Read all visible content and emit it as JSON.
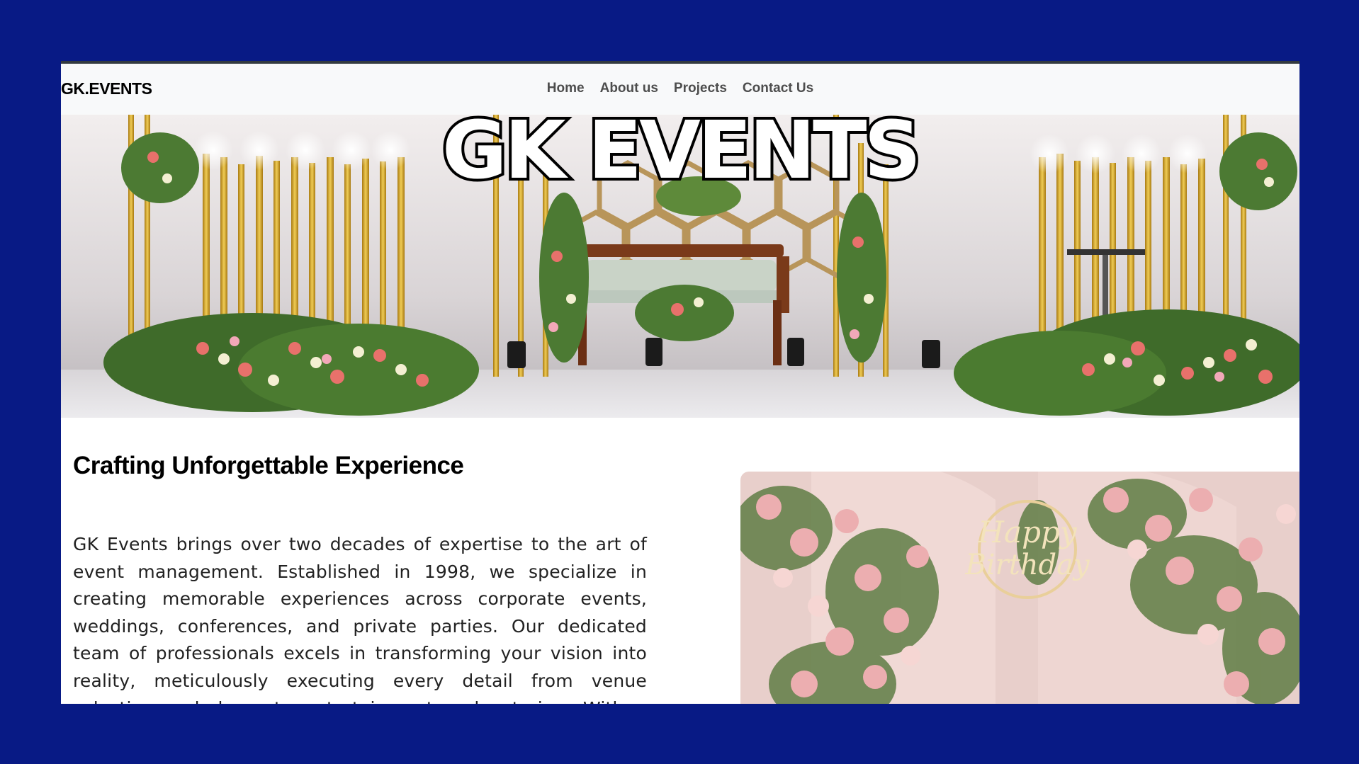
{
  "navbar": {
    "brand": "GK.EVENTS",
    "links": [
      "Home",
      "About us",
      "Projects",
      "Contact Us"
    ]
  },
  "hero": {
    "title": "GK EVENTS"
  },
  "about": {
    "heading": "Crafting Unforgettable Experience",
    "paragraph": "GK Events brings over two decades of expertise to the art of event management. Established in 1998, we specialize in creating memorable experiences across corporate events, weddings, conferences, and private parties. Our dedicated team of professionals excels in transforming your vision into reality, meticulously executing every detail from venue selection and decor to entertainment and catering. With a commitment to creativity and excellence, we ensure every event is unique and unforgettable."
  },
  "side_image": {
    "sign_text": "Happy Birthday"
  },
  "colors": {
    "page_background": "#081a85",
    "navbar_background": "#f8f9fa",
    "frame_top_border": "#333a40"
  }
}
